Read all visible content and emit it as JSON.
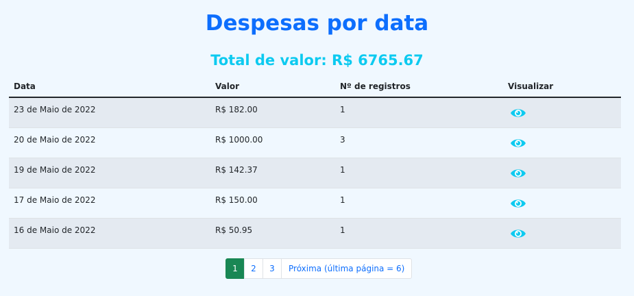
{
  "page": {
    "title": "Despesas por data",
    "total": "Total de valor: R$ 6765.67"
  },
  "table": {
    "headers": [
      "Data",
      "Valor",
      "Nº de registros",
      "Visualizar"
    ],
    "rows": [
      {
        "date": "23 de Maio de 2022",
        "value": "R$ 182.00",
        "count": "1"
      },
      {
        "date": "20 de Maio de 2022",
        "value": "R$ 1000.00",
        "count": "3"
      },
      {
        "date": "19 de Maio de 2022",
        "value": "R$ 142.37",
        "count": "1"
      },
      {
        "date": "17 de Maio de 2022",
        "value": "R$ 150.00",
        "count": "1"
      },
      {
        "date": "16 de Maio de 2022",
        "value": "R$ 50.95",
        "count": "1"
      }
    ],
    "view_icon": "eye-icon",
    "view_icon_color": "#0dcaf0"
  },
  "pagination": {
    "pages": [
      "1",
      "2",
      "3"
    ],
    "active": "1",
    "next_label": "Próxima (última página = 6)"
  },
  "colors": {
    "title": "#0d6efd",
    "total": "#0dcaf0",
    "active_page": "#198754",
    "background": "#f0f8ff"
  }
}
